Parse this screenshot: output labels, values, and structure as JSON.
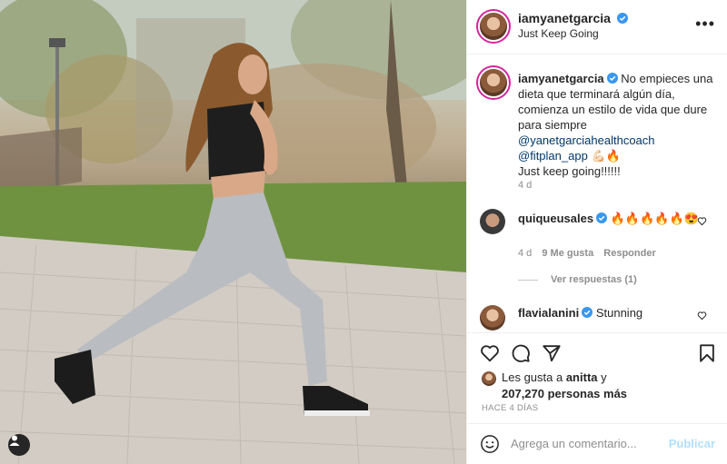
{
  "post": {
    "username": "iamyanetgarcia",
    "subtitle": "Just Keep Going",
    "more_label": "•••"
  },
  "caption": {
    "username": "iamyanetgarcia",
    "text": "No empieces una dieta que terminará algún día, comienza un estilo de vida que dure para siempre",
    "mention1": "@yanetgarciahealthcoach",
    "mention2": "@fitplan_app",
    "mention2_emoji": "💪🏻🔥",
    "last_line": "Just keep going!!!!!!",
    "age": "4 d"
  },
  "comments": [
    {
      "username": "quiqueusales",
      "text": "🔥🔥🔥🔥🔥😍",
      "age": "4 d",
      "likes": "9 Me gusta",
      "reply": "Responder",
      "view_replies": "Ver respuestas (1)"
    },
    {
      "username": "flavialanini",
      "text": "Stunning"
    }
  ],
  "actions": {
    "likes_prefix": "Les gusta a ",
    "likes_user": "anitta",
    "likes_suffix": " y",
    "likes_count": "207,270 personas más",
    "time": "HACE 4 DÍAS"
  },
  "add_comment": {
    "placeholder": "Agrega un comentario...",
    "publish": "Publicar"
  },
  "colors": {
    "verified": "#3897f0",
    "link": "#00376b",
    "muted": "#8e8e8e",
    "publish_disabled": "#b2dffc"
  }
}
